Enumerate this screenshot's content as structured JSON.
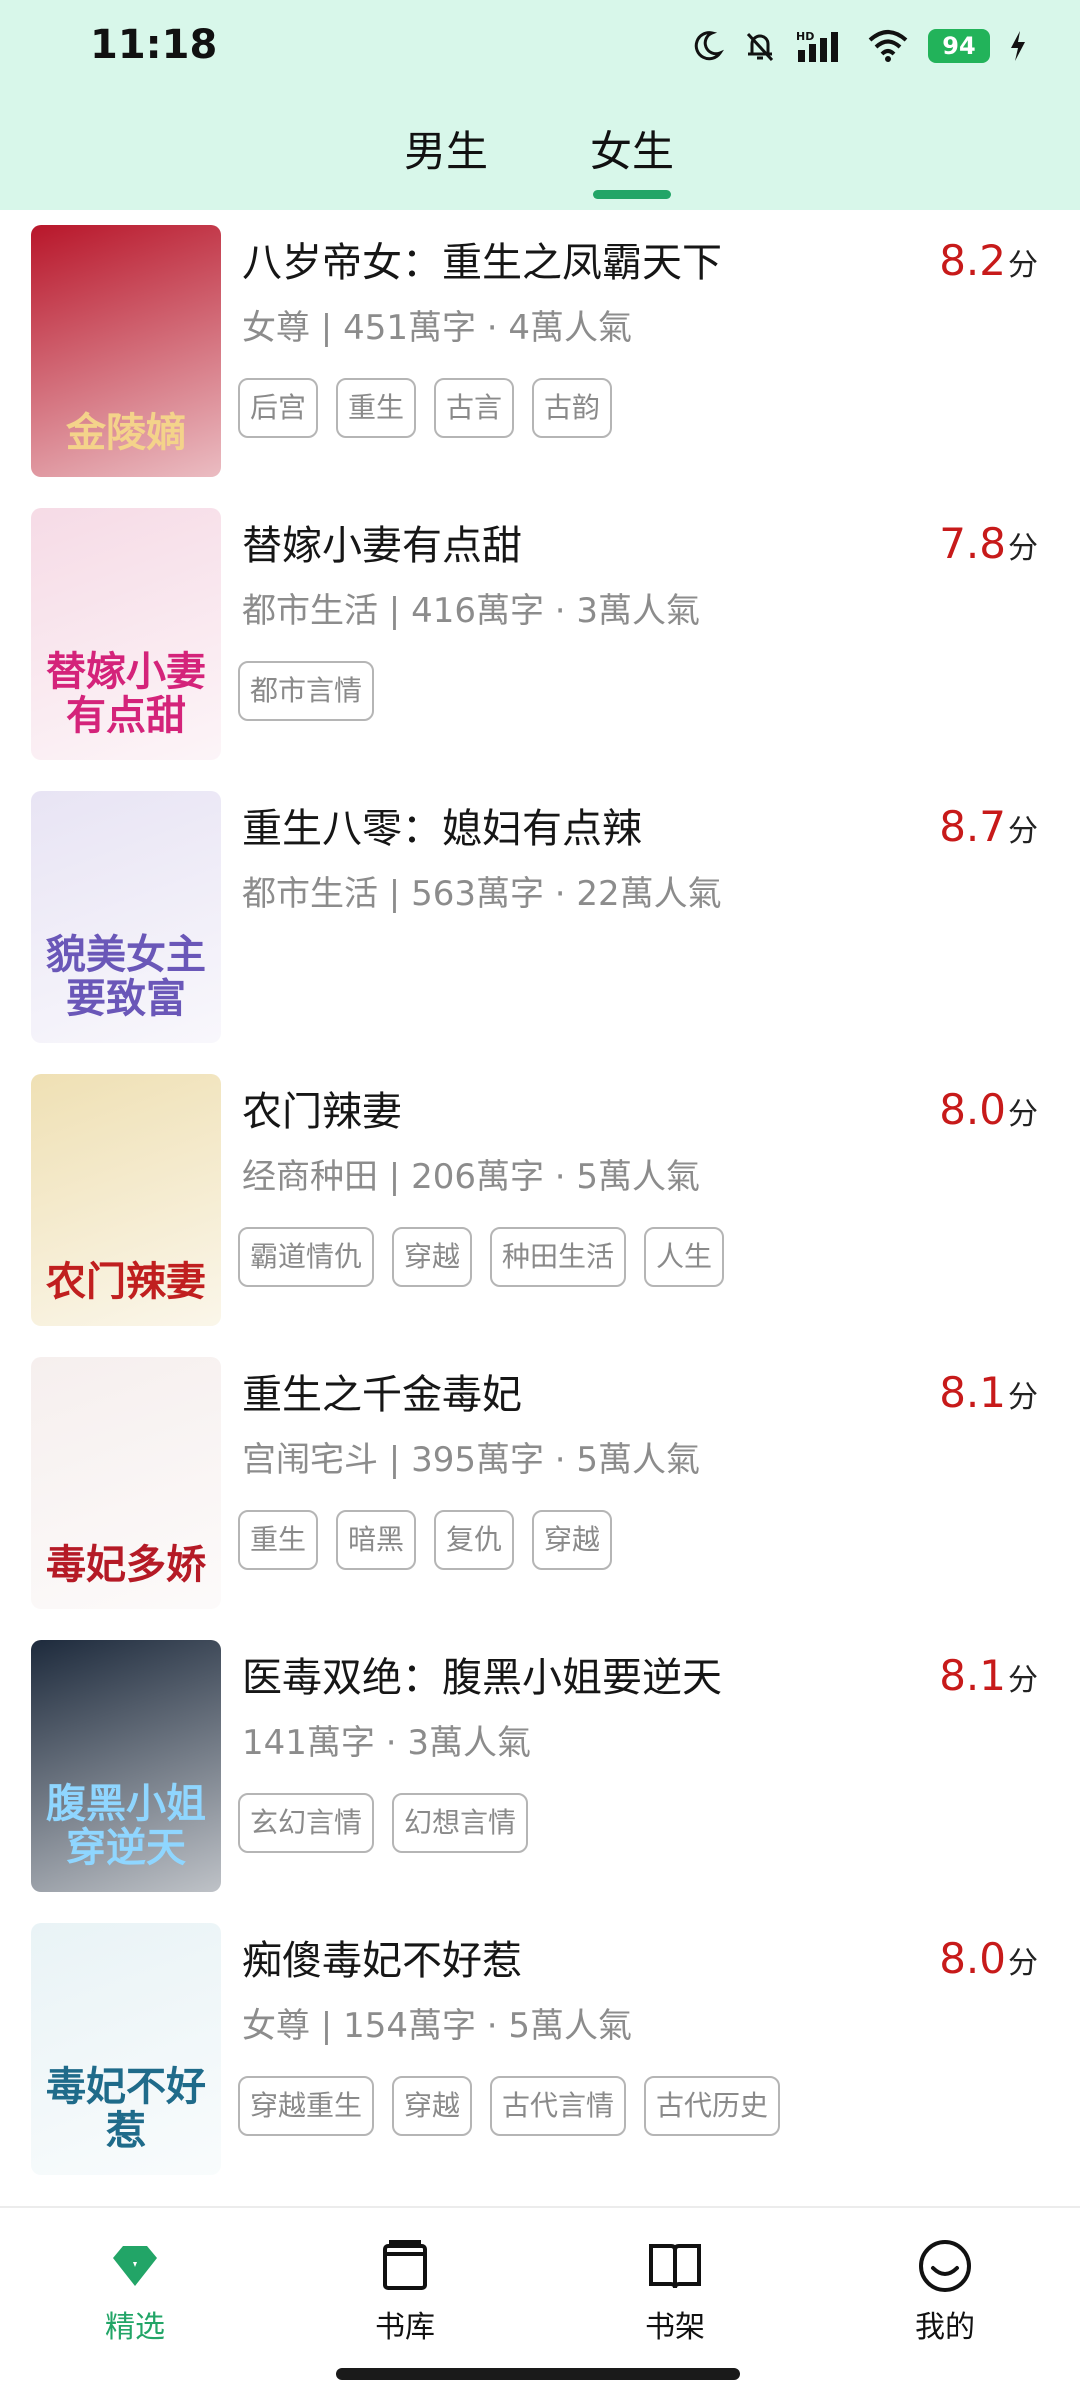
{
  "status": {
    "time": "11:18",
    "battery": "94",
    "network_label": "HD"
  },
  "tabs": [
    {
      "label": "男生"
    },
    {
      "label": "女生"
    }
  ],
  "books": [
    {
      "title": "八岁帝女：重生之凤霸天下",
      "meta": "女尊 | 451萬字 · 4萬人氣",
      "score": "8.2",
      "score_unit": "分",
      "tags": [
        "后宫",
        "重生",
        "古言",
        "古韵"
      ]
    },
    {
      "title": "替嫁小妻有点甜",
      "meta": "都市生活 | 416萬字 · 3萬人氣",
      "score": "7.8",
      "score_unit": "分",
      "tags": [
        "都市言情"
      ]
    },
    {
      "title": "重生八零：媳妇有点辣",
      "meta": "都市生活 | 563萬字 · 22萬人氣",
      "score": "8.7",
      "score_unit": "分",
      "tags": []
    },
    {
      "title": "农门辣妻",
      "meta": "经商种田 | 206萬字 · 5萬人氣",
      "score": "8.0",
      "score_unit": "分",
      "tags": [
        "霸道情仇",
        "穿越",
        "种田生活",
        "人生"
      ]
    },
    {
      "title": "重生之千金毒妃",
      "meta": "宫闱宅斗 | 395萬字 · 5萬人氣",
      "score": "8.1",
      "score_unit": "分",
      "tags": [
        "重生",
        "暗黑",
        "复仇",
        "穿越"
      ]
    },
    {
      "title": "医毒双绝：腹黑小姐要逆天",
      "meta": "141萬字 · 3萬人氣",
      "score": "8.1",
      "score_unit": "分",
      "tags": [
        "玄幻言情",
        "幻想言情"
      ]
    },
    {
      "title": "痴傻毒妃不好惹",
      "meta": "女尊 | 154萬字 · 5萬人氣",
      "score": "8.0",
      "score_unit": "分",
      "tags": [
        "穿越重生",
        "穿越",
        "古代言情",
        "古代历史"
      ]
    }
  ],
  "covers": [
    {
      "text": "金陵嫡",
      "bg": "#b8162a",
      "fg": "#f4d38a"
    },
    {
      "text": "替嫁小妻有点甜",
      "bg": "#f6dbe6",
      "fg": "#d4237a"
    },
    {
      "text": "貌美女主要致富",
      "bg": "#e8e4f4",
      "fg": "#6a57b8"
    },
    {
      "text": "农门辣妻",
      "bg": "#efe0b4",
      "fg": "#c01f1f"
    },
    {
      "text": "毒妃多娇",
      "bg": "#f6efee",
      "fg": "#b51a26"
    },
    {
      "text": "腹黑小姐穿逆天",
      "bg": "#1d2a3c",
      "fg": "#8fd6ff"
    },
    {
      "text": "毒妃不好惹",
      "bg": "#e9f3f6",
      "fg": "#1f6b8a"
    }
  ],
  "nav": [
    {
      "label": "精选",
      "icon": "gem-icon"
    },
    {
      "label": "书库",
      "icon": "library-icon"
    },
    {
      "label": "书架",
      "icon": "open-book-icon"
    },
    {
      "label": "我的",
      "icon": "smiley-icon"
    }
  ],
  "colors": {
    "accent": "#22a567",
    "score": "#c71a1a",
    "header_bg": "#d8f7ea"
  }
}
